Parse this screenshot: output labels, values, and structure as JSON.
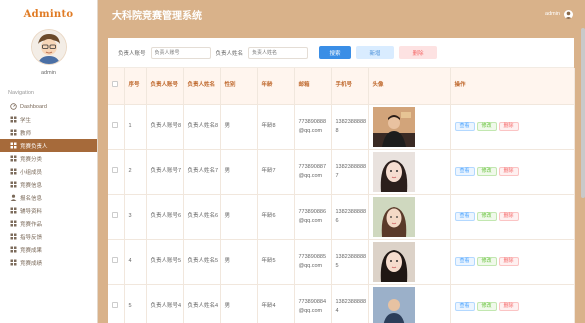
{
  "brand": "Adminto",
  "profile": {
    "name": "admin"
  },
  "nav": {
    "heading": "Navigation",
    "items": [
      {
        "label": "Dashboard",
        "icon": "dashboard-icon",
        "active": false
      },
      {
        "label": "学生",
        "icon": "grid-icon",
        "active": false
      },
      {
        "label": "教师",
        "icon": "grid-icon",
        "active": false
      },
      {
        "label": "竞赛负责人",
        "icon": "grid-icon",
        "active": true
      },
      {
        "label": "竞赛分类",
        "icon": "grid-icon",
        "active": false
      },
      {
        "label": "小组成员",
        "icon": "grid-icon",
        "active": false
      },
      {
        "label": "竞赛信息",
        "icon": "grid-icon",
        "active": false
      },
      {
        "label": "报名信息",
        "icon": "user-icon",
        "active": false
      },
      {
        "label": "辅导资料",
        "icon": "grid-icon",
        "active": false
      },
      {
        "label": "竞赛作品",
        "icon": "grid-icon",
        "active": false
      },
      {
        "label": "指导反馈",
        "icon": "grid-icon",
        "active": false
      },
      {
        "label": "竞赛成果",
        "icon": "grid-icon",
        "active": false
      },
      {
        "label": "竞赛成绩",
        "icon": "grid-icon",
        "active": false
      }
    ]
  },
  "header": {
    "title": "大科院竞赛管理系统",
    "user": "admin"
  },
  "search": {
    "account_label": "负责人账号",
    "account_placeholder": "负责人账号",
    "name_label": "负责人姓名",
    "name_placeholder": "负责人姓名",
    "search_btn": "搜索",
    "add_btn": "新增",
    "delete_btn": "删除"
  },
  "table": {
    "columns": [
      "",
      "序号",
      "负责人账号",
      "负责人姓名",
      "性别",
      "年龄",
      "邮箱",
      "手机号",
      "头像",
      "操作"
    ],
    "ops": {
      "view": "查看",
      "edit": "修改",
      "delete": "删除"
    },
    "rows": [
      {
        "index": "1",
        "account": "负责人账号8",
        "name": "负责人姓名8",
        "gender": "男",
        "age": "年龄8",
        "email": "773890888@qq.com",
        "phone": "13823888888",
        "avatar": "photo-1"
      },
      {
        "index": "2",
        "account": "负责人账号7",
        "name": "负责人姓名7",
        "gender": "男",
        "age": "年龄7",
        "email": "773890887@qq.com",
        "phone": "13823888887",
        "avatar": "photo-2"
      },
      {
        "index": "3",
        "account": "负责人账号6",
        "name": "负责人姓名6",
        "gender": "男",
        "age": "年龄6",
        "email": "773890886@qq.com",
        "phone": "13823888886",
        "avatar": "photo-3"
      },
      {
        "index": "4",
        "account": "负责人账号5",
        "name": "负责人姓名5",
        "gender": "男",
        "age": "年龄5",
        "email": "773890885@qq.com",
        "phone": "13823888885",
        "avatar": "photo-4"
      },
      {
        "index": "5",
        "account": "负责人账号4",
        "name": "负责人姓名4",
        "gender": "男",
        "age": "年龄4",
        "email": "773890884@qq.com",
        "phone": "13823888884",
        "avatar": "photo-5"
      }
    ]
  },
  "colors": {
    "accent": "#d9b28a",
    "active_nav": "#a66a3a",
    "brand": "#e07b24",
    "primary": "#3a8ee6"
  }
}
